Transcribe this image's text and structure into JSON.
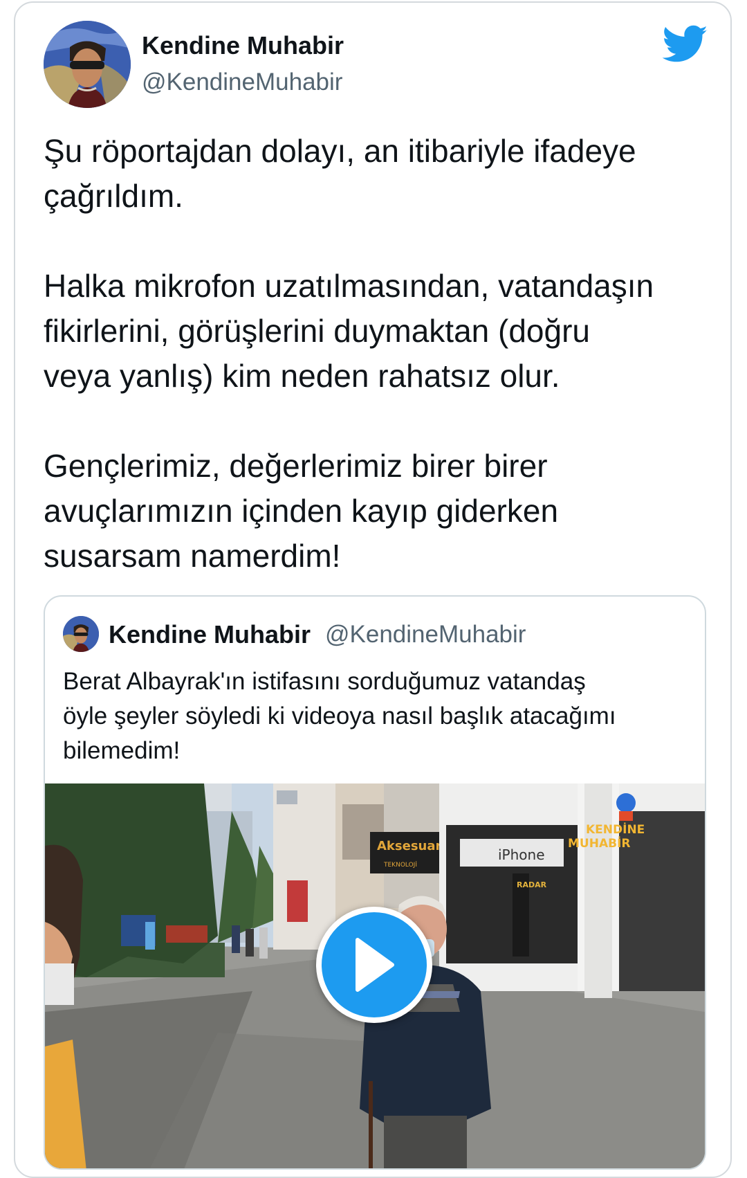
{
  "tweet": {
    "author_name": "Kendine Muhabir",
    "author_handle": "@KendineMuhabir",
    "text": "Şu röportajdan dolayı, an itibariyle ifadeye\nçağrıldım.\n\nHalka mikrofon uzatılmasından, vatandaşın\nfikirlerini, görüşlerini duymaktan (doğru\nveya yanlış) kim neden rahatsız olur.\n\nGençlerimiz, değerlerimiz birer birer\navuçlarımızın içinden kayıp giderken\nsusarsam namerdim!"
  },
  "quoted_tweet": {
    "author_name": "Kendine Muhabir",
    "author_handle": "@KendineMuhabir",
    "text": "Berat Albayrak'ın istifasını sorduğumuz vatandaş\nöyle şeyler söyledi ki videoya nasıl başlık atacağımı\nbilemedim!",
    "video": {
      "watermark_line1": "KENDİNE",
      "watermark_line2": "MUHABİR",
      "shop_sign": "Aksesuar Dünyası",
      "shop_subsign": "TEKNOLOJİ",
      "store_sign": "iPhone",
      "vertical_sign": "RADAR"
    }
  },
  "icons": {
    "brand": "twitter-bird-icon",
    "play": "play-icon"
  },
  "colors": {
    "twitter_blue": "#1d9bf0",
    "text_primary": "#0f1419",
    "text_secondary": "#536471",
    "border": "#cfd9de"
  }
}
